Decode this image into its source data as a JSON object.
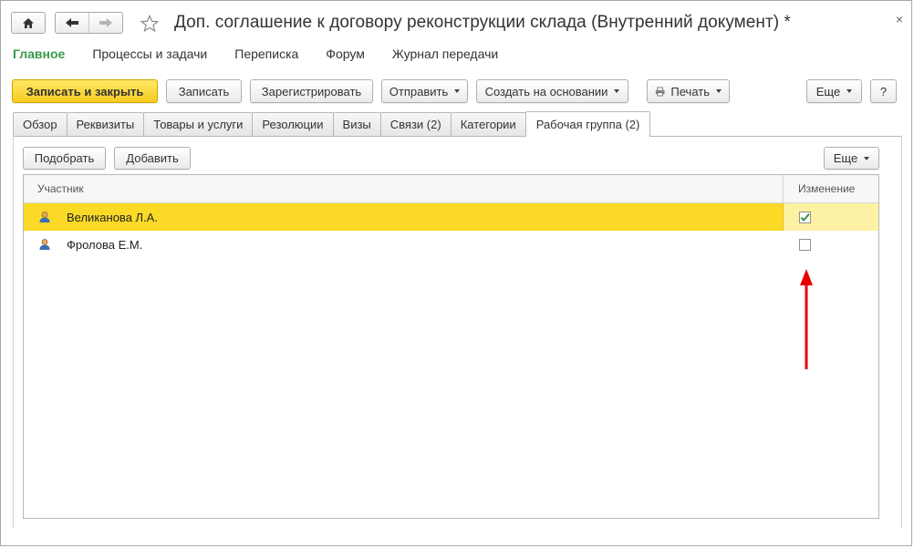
{
  "window": {
    "title": "Доп. соглашение к договору реконструкции склада (Внутренний документ) *",
    "close_label": "×",
    "home_icon": "home-icon",
    "back_icon": "arrow-left-icon",
    "forward_icon": "arrow-right-icon",
    "favorite_icon": "star-icon"
  },
  "section_nav": {
    "items": [
      {
        "label": "Главное",
        "active": true
      },
      {
        "label": "Процессы и задачи"
      },
      {
        "label": "Переписка"
      },
      {
        "label": "Форум"
      },
      {
        "label": "Журнал передачи"
      }
    ]
  },
  "toolbar": {
    "save_close": "Записать и закрыть",
    "save": "Записать",
    "register": "Зарегистрировать",
    "send": "Отправить",
    "create_based": "Создать на основании",
    "print": "Печать",
    "more": "Еще",
    "help": "?"
  },
  "tabs": [
    {
      "label": "Обзор"
    },
    {
      "label": "Реквизиты"
    },
    {
      "label": "Товары и услуги"
    },
    {
      "label": "Резолюции"
    },
    {
      "label": "Визы"
    },
    {
      "label": "Связи (2)"
    },
    {
      "label": "Категории"
    },
    {
      "label": "Рабочая группа (2)",
      "active": true
    }
  ],
  "panel_toolbar": {
    "pick": "Подобрать",
    "add": "Добавить",
    "more": "Еще"
  },
  "grid": {
    "columns": {
      "participant": "Участник",
      "change": "Изменение"
    },
    "rows": [
      {
        "name": "Великанова Л.А.",
        "change": true,
        "selected": true
      },
      {
        "name": "Фролова Е.М.",
        "change": false,
        "selected": false
      }
    ]
  },
  "colors": {
    "accent_green": "#3a9a4a",
    "primary_button": "#f7cc20",
    "selected_row": "#fada27",
    "annotation_arrow": "#e60000"
  }
}
